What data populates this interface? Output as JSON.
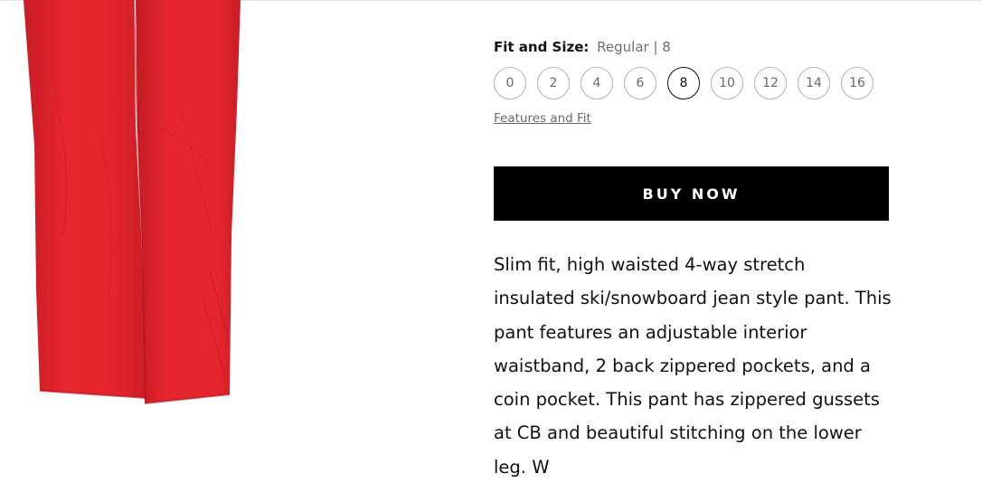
{
  "product": {
    "fit_label": "Fit and Size:",
    "fit_value": "Regular | 8",
    "sizes": [
      {
        "label": "0",
        "selected": false
      },
      {
        "label": "2",
        "selected": false
      },
      {
        "label": "4",
        "selected": false
      },
      {
        "label": "6",
        "selected": false
      },
      {
        "label": "8",
        "selected": true
      },
      {
        "label": "10",
        "selected": false
      },
      {
        "label": "12",
        "selected": false
      },
      {
        "label": "14",
        "selected": false
      },
      {
        "label": "16",
        "selected": false
      }
    ],
    "features_link": "Features and Fit",
    "buy_button": "BUY NOW",
    "description": "Slim fit, high waisted 4-way stretch insulated ski/snowboard jean style pant. This pant features an adjustable interior waistband, 2 back zippered pockets, and a coin pocket. This pant has zippered gussets at CB and beautiful stitching on the lower leg. W"
  },
  "colors": {
    "pant_red": "#e4252d",
    "button_bg": "#000000",
    "text_primary": "#111111",
    "text_muted": "#6a6a6a"
  }
}
